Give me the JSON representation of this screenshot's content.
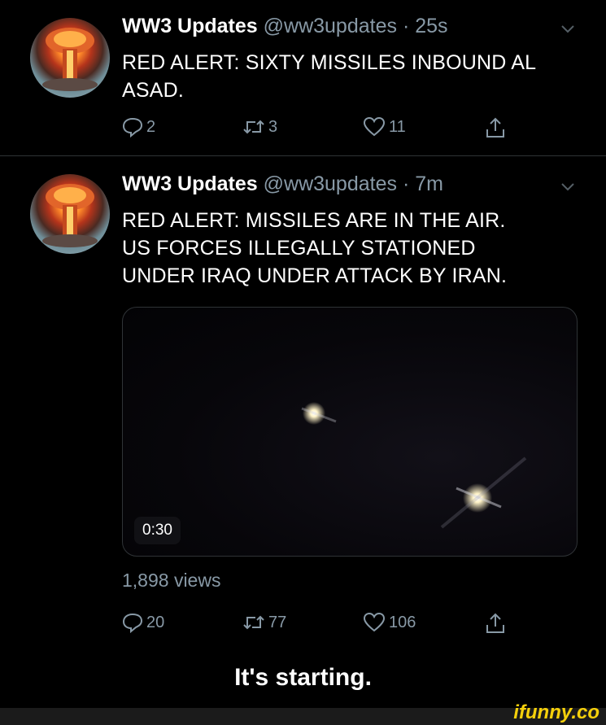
{
  "tweets": [
    {
      "name": "WW3 Updates",
      "handle": "@ww3updates · 25s",
      "text_lines": [
        "RED ALERT: SIXTY MISSILES INBOUND AL",
        "ASAD."
      ],
      "replies": "2",
      "retweets": "3",
      "likes": "11"
    },
    {
      "name": "WW3 Updates",
      "handle": "@ww3updates · 7m",
      "text_lines": [
        "RED ALERT: MISSILES ARE IN THE AIR.",
        "US FORCES ILLEGALLY STATIONED",
        "UNDER IRAQ UNDER ATTACK BY IRAN."
      ],
      "video_duration": "0:30",
      "views": "1,898 views",
      "replies": "20",
      "retweets": "77",
      "likes": "106"
    }
  ],
  "caption": "It's starting.",
  "watermark": "ifunny.co",
  "icons": {
    "reply": "reply-icon",
    "retweet": "retweet-icon",
    "like": "heart-icon",
    "share": "share-icon",
    "menu": "chevron-down-icon"
  },
  "colors": {
    "background": "#000000",
    "secondary_text": "#8899a6",
    "watermark": "#f5d00b"
  }
}
